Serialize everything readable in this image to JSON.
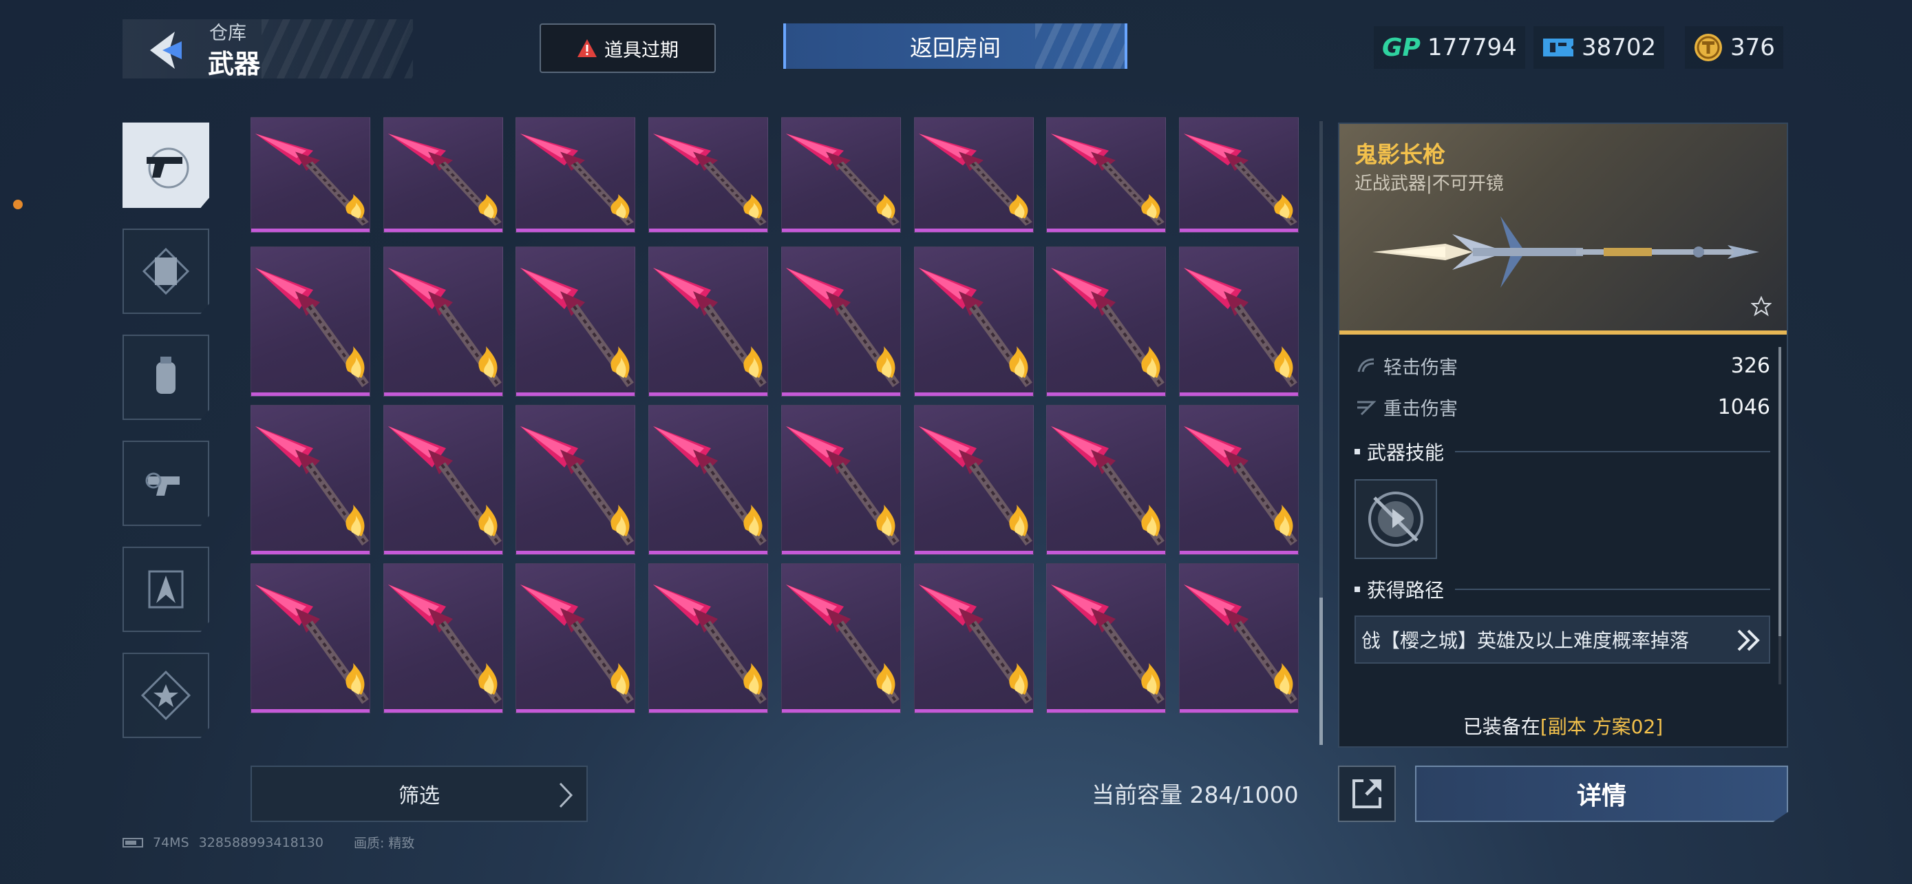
{
  "header": {
    "category_sub": "仓库",
    "category_main": "武器",
    "expire_label": "道具过期",
    "return_label": "返回房间"
  },
  "currencies": {
    "gp_label": "GP",
    "gp": "177794",
    "ticket": "38702",
    "coin": "376"
  },
  "sidebar": {
    "items": [
      {
        "name": "pistol",
        "active": true
      },
      {
        "name": "scroll",
        "active": false
      },
      {
        "name": "grenade",
        "active": false
      },
      {
        "name": "gear",
        "active": false
      },
      {
        "name": "compass",
        "active": false
      },
      {
        "name": "star",
        "active": false
      }
    ]
  },
  "inventory": {
    "rows": 4,
    "cols": 8,
    "item_name": "spear",
    "rarity_color": "#c55ad8"
  },
  "detail": {
    "name": "鬼影长枪",
    "type": "近战武器|不可开镜",
    "stats": [
      {
        "label": "轻击伤害",
        "value": "326"
      },
      {
        "label": "重击伤害",
        "value": "1046"
      }
    ],
    "skill_title": "武器技能",
    "route_title": "获得路径",
    "route_text": "戗【樱之城】英雄及以上难度概率掉落",
    "equipped_prefix": "已装备在",
    "equipped_highlight": "[副本 方案02]"
  },
  "bottom": {
    "filter_label": "筛选",
    "capacity": "当前容量 284/1000",
    "details_label": "详情"
  },
  "status": {
    "ping": "74MS",
    "id": "328588993418130",
    "quality": "画质: 精致"
  },
  "colors": {
    "accent_gold": "#f3c14c",
    "accent_blue": "#335f9c",
    "rarity_purple": "#c55ad8"
  }
}
